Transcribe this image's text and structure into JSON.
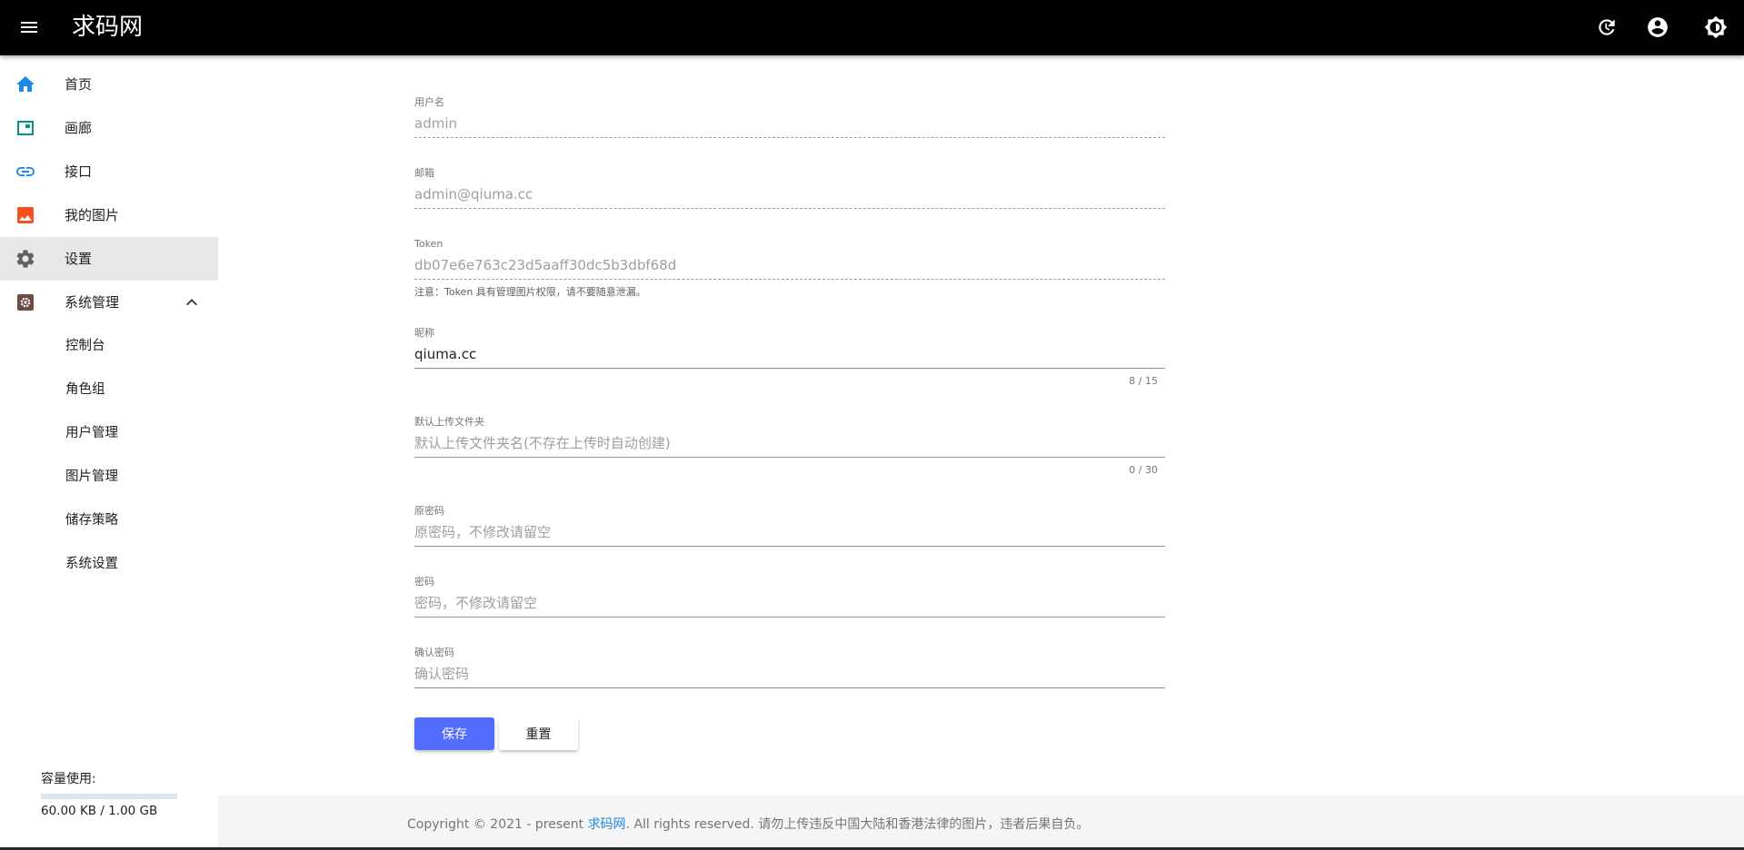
{
  "app": {
    "title": "求码网"
  },
  "colors": {
    "topbar": "#000000",
    "accent": "#536dfe",
    "link": "#1e88e5",
    "active_nav_bg": "#e8e8e8"
  },
  "topbar_icons": [
    "menu-icon",
    "refresh-icon",
    "account-circle-icon",
    "brightness-icon"
  ],
  "sidebar": {
    "items": [
      {
        "label": "首页",
        "icon": "home-icon"
      },
      {
        "label": "画廊",
        "icon": "gallery-icon"
      },
      {
        "label": "接口",
        "icon": "link-icon"
      },
      {
        "label": "我的图片",
        "icon": "image-icon"
      },
      {
        "label": "设置",
        "icon": "gear-icon",
        "active": true
      },
      {
        "label": "系统管理",
        "icon": "system-icon",
        "expanded": true
      }
    ],
    "sub_items": [
      {
        "label": "控制台"
      },
      {
        "label": "角色组"
      },
      {
        "label": "用户管理"
      },
      {
        "label": "图片管理"
      },
      {
        "label": "储存策略"
      },
      {
        "label": "系统设置"
      }
    ],
    "storage": {
      "title": "容量使用:",
      "usage": "60.00 KB / 1.00 GB",
      "fraction": 0.0001
    }
  },
  "form": {
    "username": {
      "label": "用户名",
      "value": "admin"
    },
    "email": {
      "label": "邮箱",
      "value": "admin@qiuma.cc"
    },
    "token": {
      "label": "Token",
      "value": "db07e6e763c23d5aaff30dc5b3dbf68d",
      "hint": "注意：Token 具有管理图片权限，请不要随意泄漏。"
    },
    "nickname": {
      "label": "昵称",
      "value": "qiuma.cc",
      "counter": "8 / 15"
    },
    "default_folder": {
      "label": "默认上传文件夹",
      "value": "",
      "placeholder": "默认上传文件夹名(不存在上传时自动创建)",
      "counter": "0 / 30"
    },
    "old_password": {
      "label": "原密码",
      "value": "",
      "placeholder": "原密码，不修改请留空"
    },
    "password": {
      "label": "密码",
      "value": "",
      "placeholder": "密码，不修改请留空"
    },
    "confirm_password": {
      "label": "确认密码",
      "value": "",
      "placeholder": "确认密码"
    },
    "save_label": "保存",
    "reset_label": "重置"
  },
  "footer": {
    "prefix": "Copyright © 2021 - present ",
    "link": "求码网",
    "suffix": ". All rights reserved. 请勿上传违反中国大陆和香港法律的图片，违者后果自负。"
  }
}
